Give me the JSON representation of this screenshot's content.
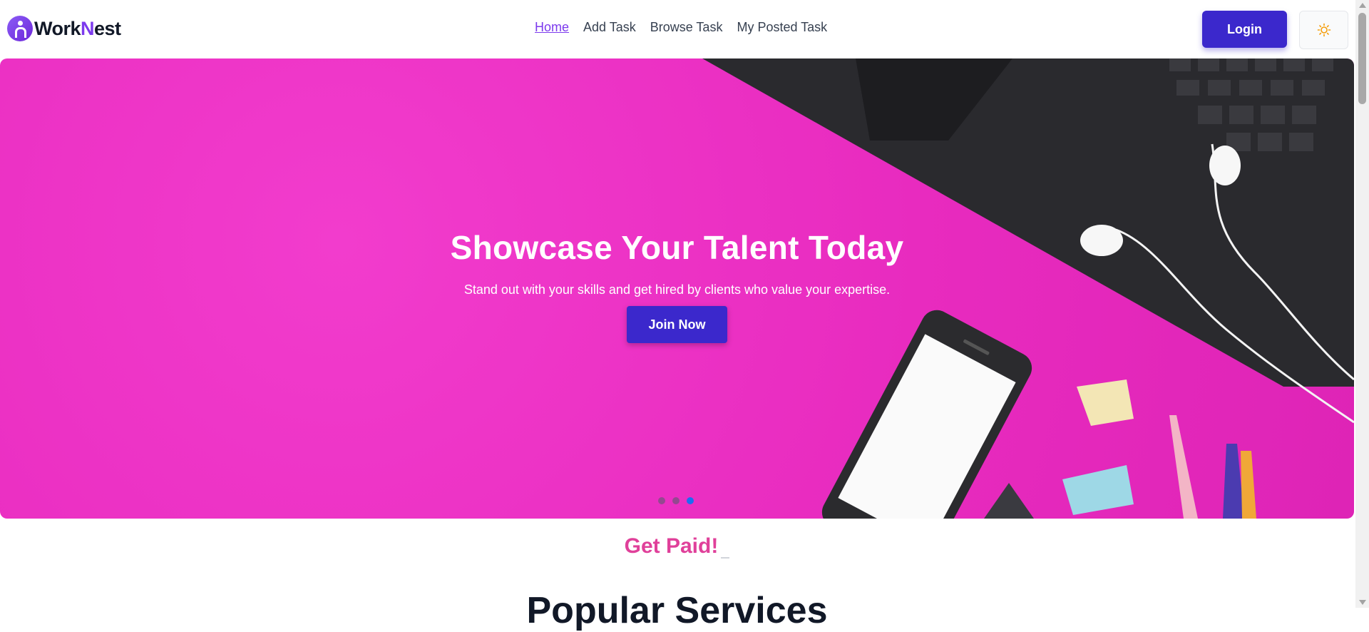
{
  "brand": {
    "prefix": "Work",
    "accent": "N",
    "suffix": "est"
  },
  "nav": {
    "links": [
      {
        "label": "Home"
      },
      {
        "label": "Add Task"
      },
      {
        "label": "Browse Task"
      },
      {
        "label": "My Posted Task"
      }
    ],
    "active": "Home",
    "login_label": "Login",
    "theme_toggle_icon": "sun-icon"
  },
  "hero": {
    "title": "Showcase Your Talent Today",
    "subtitle": "Stand out with your skills and get hired by clients who value your expertise.",
    "cta_label": "Join Now",
    "slides_count": 3,
    "active_slide": 3
  },
  "tagline": "Get Paid!",
  "next_section": {
    "title": "Popular Services"
  },
  "colors": {
    "primary": "#3b28cc",
    "accent": "#7c3aed",
    "hero_bg": "#ec2fc4",
    "tagline": "#e0409a",
    "dot_active": "#1d6cf2"
  }
}
